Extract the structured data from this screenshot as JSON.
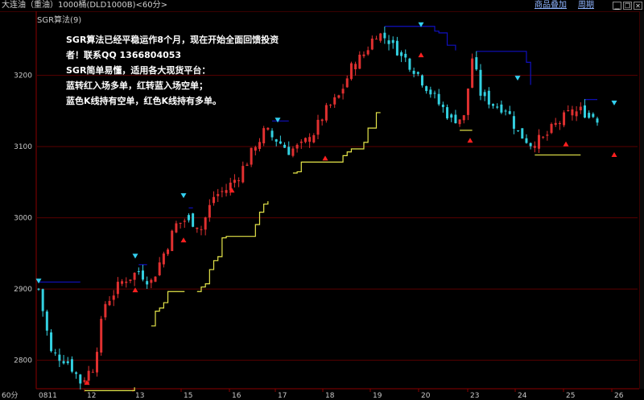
{
  "header": {
    "title": "大连油（重油）1000桶(DLD1000B)<60分>",
    "link_products": "商品叠加",
    "link_period": "周期",
    "indicator_label": "SGR算法(9)"
  },
  "annotation": {
    "line1": "SGR算法已经平稳运作8个月，现在开始全面回馈投资",
    "line2": "者！联系QQ 1366804053",
    "line3": "SGR简单易懂，适用各大现货平台：",
    "line4": "蓝转红入场多单，红转蓝入场空单；",
    "line5": "蓝色K线持有空单，红色K线持有多单。"
  },
  "axis": {
    "period_label": "60分",
    "start_label": "0811"
  },
  "chart_data": {
    "type": "candlestick",
    "y_ticks": [
      2800,
      2900,
      3000,
      3100,
      3200
    ],
    "y_range": [
      2760,
      3290
    ],
    "x_ticks": [
      "0811",
      "12",
      "13",
      "15",
      "16",
      "17",
      "18",
      "19",
      "20",
      "23",
      "24",
      "25",
      "26"
    ],
    "colors": {
      "up": "#e03030",
      "down": "#33d0e0",
      "stop_long": "#e6e64a",
      "stop_short": "#1010c0",
      "grid": "#5a0000"
    },
    "price_path": [
      [
        0,
        2900
      ],
      [
        3,
        2810
      ],
      [
        7,
        2800
      ],
      [
        10,
        2770
      ],
      [
        13,
        2790
      ],
      [
        16,
        2880
      ],
      [
        20,
        2910
      ],
      [
        24,
        2925
      ],
      [
        27,
        2910
      ],
      [
        30,
        2950
      ],
      [
        33,
        2990
      ],
      [
        36,
        3000
      ],
      [
        39,
        2985
      ],
      [
        42,
        3030
      ],
      [
        45,
        3040
      ],
      [
        48,
        3060
      ],
      [
        51,
        3090
      ],
      [
        54,
        3120
      ],
      [
        57,
        3110
      ],
      [
        60,
        3095
      ],
      [
        63,
        3100
      ],
      [
        66,
        3120
      ],
      [
        69,
        3150
      ],
      [
        72,
        3170
      ],
      [
        75,
        3210
      ],
      [
        78,
        3230
      ],
      [
        81,
        3260
      ],
      [
        84,
        3250
      ],
      [
        87,
        3230
      ],
      [
        90,
        3210
      ],
      [
        93,
        3185
      ],
      [
        96,
        3160
      ],
      [
        99,
        3140
      ],
      [
        102,
        3140
      ],
      [
        104,
        3225
      ],
      [
        106,
        3175
      ],
      [
        109,
        3160
      ],
      [
        112,
        3155
      ],
      [
        115,
        3120
      ],
      [
        118,
        3105
      ],
      [
        121,
        3110
      ],
      [
        124,
        3130
      ],
      [
        127,
        3145
      ],
      [
        130,
        3150
      ],
      [
        132,
        3148
      ],
      [
        134,
        3140
      ]
    ],
    "sell_signals": [
      {
        "x": "0811",
        "y": 2910
      },
      {
        "x": "13",
        "y": 2945
      },
      {
        "x": "15",
        "y": 3030
      },
      {
        "x": "17",
        "y": 3136
      },
      {
        "x": "20",
        "y": 3270
      },
      {
        "x": "24",
        "y": 3195
      },
      {
        "x": "26",
        "y": 3160
      }
    ],
    "buy_signals": [
      {
        "x": "12",
        "y": 2770
      },
      {
        "x": "13",
        "y": 2900
      },
      {
        "x": "15",
        "y": 2970
      },
      {
        "x": "16",
        "y": 3040
      },
      {
        "x": "18",
        "y": 3085
      },
      {
        "x": "20",
        "y": 3230
      },
      {
        "x": "23",
        "y": 3110
      },
      {
        "x": "25",
        "y": 3105
      },
      {
        "x": "26",
        "y": 3090
      }
    ]
  }
}
